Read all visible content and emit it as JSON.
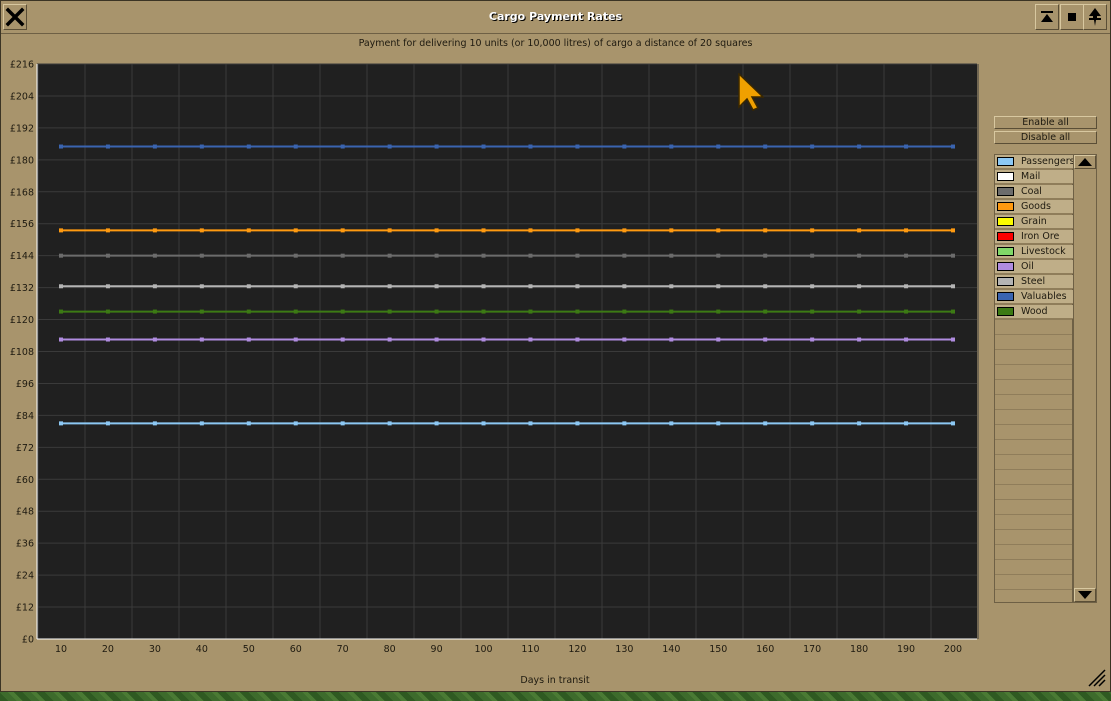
{
  "window": {
    "title": "Cargo Payment Rates",
    "subtitle": "Payment for delivering 10 units (or 10,000 litres) of cargo a distance of 20 squares"
  },
  "buttons": {
    "enable_all": "Enable all",
    "disable_all": "Disable all"
  },
  "chart_data": {
    "type": "line",
    "xlabel": "Days in transit",
    "ylim": [
      0,
      216
    ],
    "y_ticks": [
      "£0",
      "£12",
      "£24",
      "£36",
      "£48",
      "£60",
      "£72",
      "£84",
      "£96",
      "£108",
      "£120",
      "£132",
      "£144",
      "£156",
      "£168",
      "£180",
      "£192",
      "£204",
      "£216"
    ],
    "y_tick_values": [
      0,
      12,
      24,
      36,
      48,
      60,
      72,
      84,
      96,
      108,
      120,
      132,
      144,
      156,
      168,
      180,
      192,
      204,
      216
    ],
    "x": [
      10,
      20,
      30,
      40,
      50,
      60,
      70,
      80,
      90,
      100,
      110,
      120,
      130,
      140,
      150,
      160,
      170,
      180,
      190,
      200
    ],
    "grid": true,
    "series": [
      {
        "name": "Valuables",
        "color": "#3a64b0",
        "value": 185
      },
      {
        "name": "Goods",
        "color": "#ff9a10",
        "value": 153.5
      },
      {
        "name": "Coal",
        "color": "#6c6c6c",
        "value": 144
      },
      {
        "name": "Steel",
        "color": "#b4b4b4",
        "value": 132.5
      },
      {
        "name": "Wood",
        "color": "#3c7a14",
        "value": 123
      },
      {
        "name": "Oil",
        "color": "#b08ce0",
        "value": 112.5
      },
      {
        "name": "Passengers",
        "color": "#8cc8f4",
        "value": 81
      }
    ]
  },
  "legend": [
    {
      "label": "Passengers",
      "color": "#8cc8f4"
    },
    {
      "label": "Mail",
      "color": "#ffffff"
    },
    {
      "label": "Coal",
      "color": "#6c6c6c"
    },
    {
      "label": "Goods",
      "color": "#ff9a10"
    },
    {
      "label": "Grain",
      "color": "#fcfc00"
    },
    {
      "label": "Iron Ore",
      "color": "#fc0000"
    },
    {
      "label": "Livestock",
      "color": "#80d868"
    },
    {
      "label": "Oil",
      "color": "#b08ce0"
    },
    {
      "label": "Steel",
      "color": "#b4b4b4"
    },
    {
      "label": "Valuables",
      "color": "#3a64b0"
    },
    {
      "label": "Wood",
      "color": "#3c7a14"
    }
  ]
}
